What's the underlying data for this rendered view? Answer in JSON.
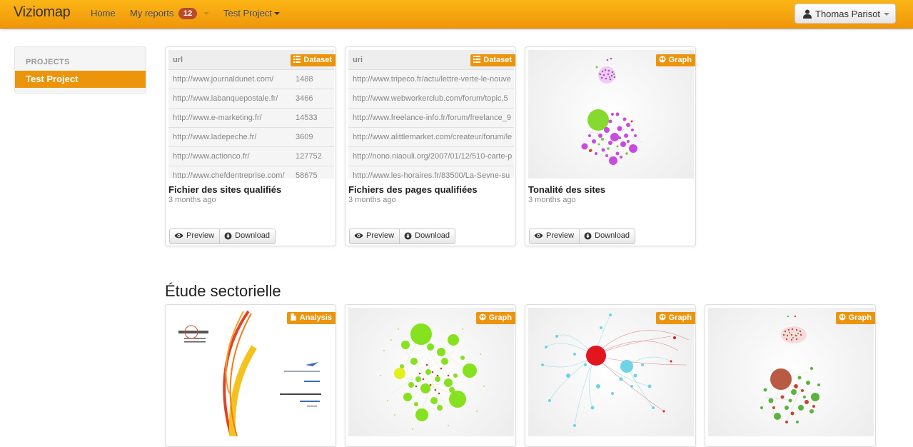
{
  "navbar": {
    "brand": "Viziomap",
    "home": "Home",
    "reports": "My reports",
    "reports_badge": "12",
    "project": "Test Project",
    "user": "Thomas Parisot",
    "accent_color": "#ec940c"
  },
  "sidebar": {
    "header": "PROJECTS",
    "items": [
      {
        "label": "Test Project",
        "active": true
      }
    ]
  },
  "actions": {
    "preview": "Preview",
    "download": "Download"
  },
  "cards_row1": [
    {
      "type": "Dataset",
      "title": "Fichier des sites qualifiés",
      "time": "3 months ago",
      "table": {
        "header": "url",
        "rows": [
          {
            "url": "http://www.journaldunet.com/",
            "n": "1488"
          },
          {
            "url": "http://www.labanquepostale.fr/",
            "n": "3466"
          },
          {
            "url": "http://www.e-marketing.fr/",
            "n": "14533"
          },
          {
            "url": "http://www.ladepeche.fr/",
            "n": "3609"
          },
          {
            "url": "http://www.actionco.fr/",
            "n": "127752"
          },
          {
            "url": "http://www.chefdentreprise.com/",
            "n": "58675"
          }
        ]
      }
    },
    {
      "type": "Dataset",
      "title": "Fichiers des pages qualifiées",
      "time": "3 months ago",
      "table": {
        "header": "uri",
        "rows": [
          {
            "url": "http://www.tripeco.fr/actu/lettre-verte-le-nouve"
          },
          {
            "url": "http://www.webworkerclub.com/forum/topic,5"
          },
          {
            "url": "http://www.freelance-info.fr/forum/freelance_9"
          },
          {
            "url": "http://www.alittlemarket.com/createur/forum/le"
          },
          {
            "url": "http://nono.niaouli.org/2007/01/12/510-carte-p"
          },
          {
            "url": "http://www.les-horaires.fr/83500/La-Seyne-su"
          }
        ]
      }
    },
    {
      "type": "Graph",
      "title": "Tonalité des sites",
      "time": "3 months ago"
    }
  ],
  "section": {
    "title": "Étude sectorielle"
  },
  "cards_row2": [
    {
      "type": "Analysis"
    },
    {
      "type": "Graph"
    },
    {
      "type": "Graph"
    },
    {
      "type": "Graph"
    }
  ]
}
